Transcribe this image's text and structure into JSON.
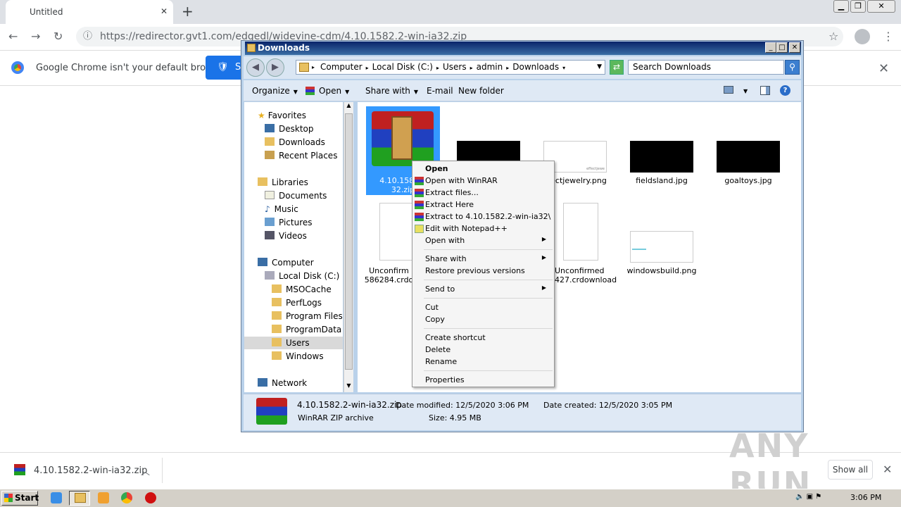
{
  "browser": {
    "tab_title": "Untitled",
    "url": "https://redirector.gvt1.com/edgedl/widevine-cdm/4.10.1582.2-win-ia32.zip",
    "infobar_text": "Google Chrome isn't your default browser",
    "infobar_button": "S"
  },
  "explorer": {
    "title": "Downloads",
    "breadcrumb": [
      "Computer",
      "Local Disk (C:)",
      "Users",
      "admin",
      "Downloads"
    ],
    "search_placeholder": "Search Downloads",
    "commands": [
      "Organize",
      "Open",
      "Share with",
      "E-mail",
      "New folder"
    ],
    "nav": {
      "favorites": "Favorites",
      "fav_items": [
        "Desktop",
        "Downloads",
        "Recent Places"
      ],
      "libraries": "Libraries",
      "lib_items": [
        "Documents",
        "Music",
        "Pictures",
        "Videos"
      ],
      "computer": "Computer",
      "disk": "Local Disk (C:)",
      "folders": [
        "MSOCache",
        "PerfLogs",
        "Program Files",
        "ProgramData",
        "Users",
        "Windows"
      ],
      "network": "Network"
    },
    "files": [
      {
        "line1": "4.10.1582.2",
        "line2": "32.zip"
      },
      {
        "line1": "ectjewelry.png",
        "line2": ""
      },
      {
        "line1": "fieldsland.jpg",
        "line2": ""
      },
      {
        "line1": "goaltoys.jpg",
        "line2": ""
      },
      {
        "line1": "Unconfirm",
        "line2": "586284.crdo"
      },
      {
        "line1": "Unconfirmed",
        "line2": "427.crdownload"
      },
      {
        "line1": "windowsbuild.png",
        "line2": ""
      }
    ],
    "thumb_caption": "effectjewe",
    "details": {
      "name": "4.10.1582.2-win-ia32.zip",
      "type": "WinRAR ZIP archive",
      "modified_label": "Date modified:",
      "modified": "12/5/2020 3:06 PM",
      "created_label": "Date created:",
      "created": "12/5/2020 3:05 PM",
      "size_label": "Size:",
      "size": "4.95 MB"
    }
  },
  "context_menu": {
    "items": [
      "Open",
      "Open with WinRAR",
      "Extract files...",
      "Extract Here",
      "Extract to 4.10.1582.2-win-ia32\\",
      "Edit with Notepad++",
      "Open with",
      "Share with",
      "Restore previous versions",
      "Send to",
      "Cut",
      "Copy",
      "Create shortcut",
      "Delete",
      "Rename",
      "Properties"
    ]
  },
  "shelf": {
    "download_name": "4.10.1582.2-win-ia32.zip",
    "show_all": "Show all"
  },
  "watermark": "ANY RUN",
  "taskbar": {
    "start": "Start",
    "clock": "3:06 PM"
  },
  "colors": {
    "chrome_blue": "#1a73e8",
    "explorer_frame": "#b9d1ea",
    "title_bar": "#0a246a"
  }
}
